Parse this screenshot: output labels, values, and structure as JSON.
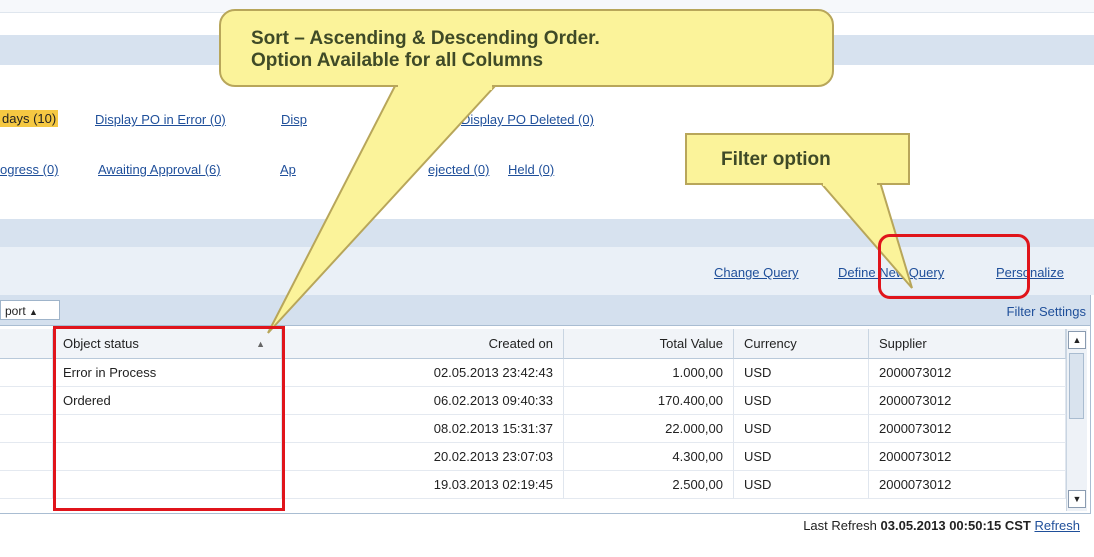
{
  "quick_links_row1": {
    "highlighted": "days (10)",
    "links": [
      "Display PO in Error (0)",
      "Disp",
      "Display PO Deleted (0)"
    ]
  },
  "quick_links_row2": {
    "links": [
      "ogress (0)",
      "Awaiting Approval (6)",
      "Ap",
      "ejected (0)",
      "Held (0)"
    ]
  },
  "query_links": {
    "change_query": "Change Query",
    "define_new_query": "Define New Query",
    "personalize": "Personalize"
  },
  "toolbar": {
    "export_label": "port",
    "filter_settings": "Filter Settings"
  },
  "table": {
    "columns": [
      "Object status",
      "Created on",
      "Total Value",
      "Currency",
      "Supplier"
    ],
    "rows": [
      [
        "Error in Process",
        "02.05.2013 23:42:43",
        "1.000,00",
        "USD",
        "2000073012"
      ],
      [
        "Ordered",
        "06.02.2013 09:40:33",
        "170.400,00",
        "USD",
        "2000073012"
      ],
      [
        "",
        "08.02.2013 15:31:37",
        "22.000,00",
        "USD",
        "2000073012"
      ],
      [
        "",
        "20.02.2013 23:07:03",
        "4.300,00",
        "USD",
        "2000073012"
      ],
      [
        "",
        "19.03.2013 02:19:45",
        "2.500,00",
        "USD",
        "2000073012"
      ]
    ]
  },
  "footer": {
    "last_refresh_label": "Last Refresh",
    "last_refresh_value": "03.05.2013 00:50:15 CST",
    "refresh_link": "Refresh"
  },
  "callouts": {
    "sort_line1": "Sort – Ascending & Descending Order.",
    "sort_line2": "Option Available for all Columns",
    "filter": "Filter option"
  },
  "colors": {
    "callout_fill": "#fbf39a",
    "highlight_box": "#e0141b",
    "link": "#1f4f9a",
    "table_header": "#d4e0ee"
  }
}
